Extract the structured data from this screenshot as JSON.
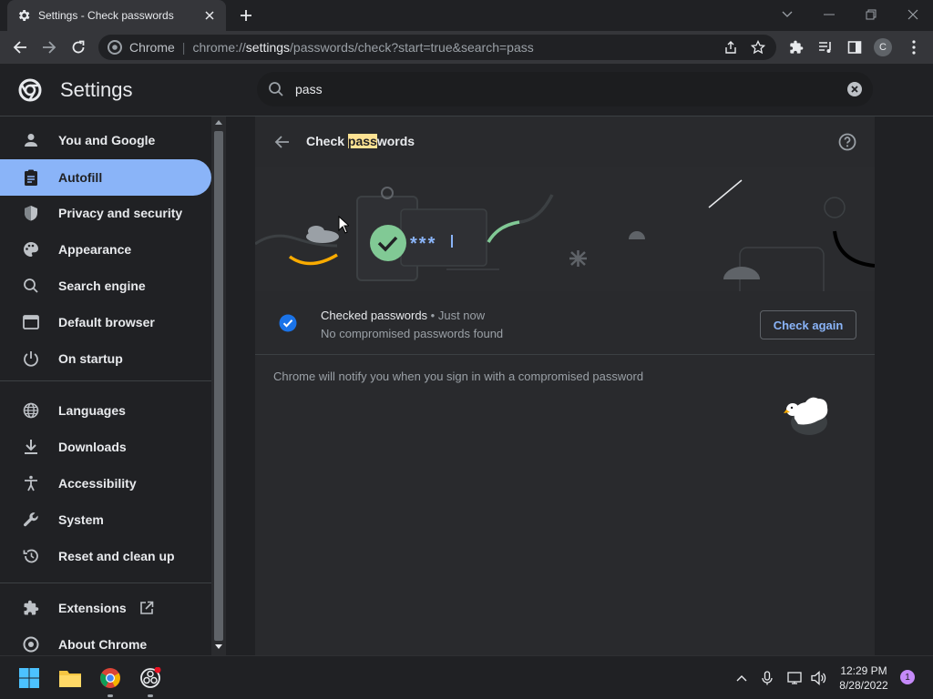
{
  "browser": {
    "tab_title": "Settings - Check passwords",
    "omnibox_site": "Chrome",
    "url_prefix": "chrome://",
    "url_highlight": "settings",
    "url_rest": "/passwords/check?start=true&search=pass",
    "profile_initial": "C"
  },
  "settings": {
    "title": "Settings",
    "search_value": "pass"
  },
  "sidebar": {
    "items": [
      {
        "label": "You and Google",
        "icon": "person-icon"
      },
      {
        "label": "Autofill",
        "icon": "clipboard-icon",
        "active": true
      },
      {
        "label": "Privacy and security",
        "icon": "shield-icon"
      },
      {
        "label": "Appearance",
        "icon": "palette-icon"
      },
      {
        "label": "Search engine",
        "icon": "search-icon"
      },
      {
        "label": "Default browser",
        "icon": "browser-icon"
      },
      {
        "label": "On startup",
        "icon": "power-icon"
      },
      {
        "label": "Languages",
        "icon": "globe-icon"
      },
      {
        "label": "Downloads",
        "icon": "download-icon"
      },
      {
        "label": "Accessibility",
        "icon": "accessibility-icon"
      },
      {
        "label": "System",
        "icon": "wrench-icon"
      },
      {
        "label": "Reset and clean up",
        "icon": "history-icon"
      },
      {
        "label": "Extensions",
        "icon": "puzzle-icon"
      },
      {
        "label": "About Chrome",
        "icon": "chrome-icon"
      }
    ]
  },
  "page": {
    "title_before": "Check ",
    "title_match": "pass",
    "title_after": "words",
    "status_title": "Checked passwords",
    "status_time": " • Just now",
    "status_sub": "No compromised passwords found",
    "check_again": "Check again",
    "notify": "Chrome will notify you when you sign in with a compromised password",
    "banner_stars": "***"
  },
  "taskbar": {
    "time": "12:29 PM",
    "date": "8/28/2022",
    "notification_count": "1"
  },
  "colors": {
    "accent": "#8ab4f8",
    "check_blue": "#1a73e8",
    "highlight": "#fde293"
  }
}
